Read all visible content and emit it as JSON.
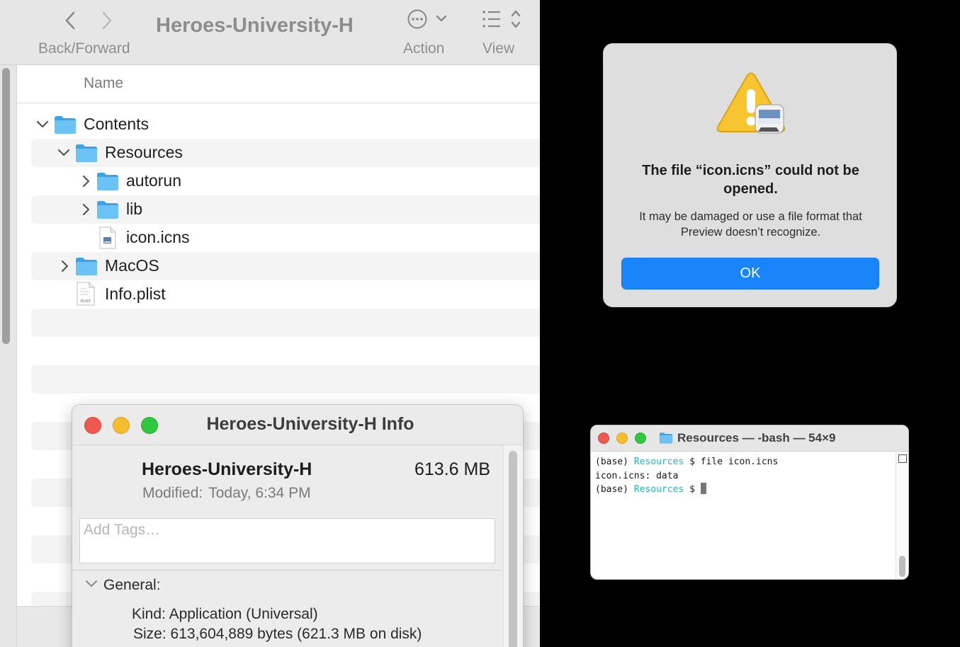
{
  "finder": {
    "title": "Heroes-University-H",
    "toolbar": {
      "nav_label": "Back/Forward",
      "action_label": "Action",
      "view_label": "View",
      "back_icon": "chevron-left-icon",
      "forward_icon": "chevron-right-icon",
      "action_icon": "ellipsis-circle-icon",
      "view_icon": "list-view-icon"
    },
    "column_header": "Name",
    "rows": [
      {
        "name": "Contents",
        "kind": "folder",
        "expanded": true,
        "depth": 0
      },
      {
        "name": "Resources",
        "kind": "folder",
        "expanded": true,
        "depth": 1
      },
      {
        "name": "autorun",
        "kind": "folder",
        "expanded": false,
        "depth": 2
      },
      {
        "name": "lib",
        "kind": "folder",
        "expanded": false,
        "depth": 2
      },
      {
        "name": "icon.icns",
        "kind": "file",
        "depth": 2
      },
      {
        "name": "MacOS",
        "kind": "folder",
        "expanded": false,
        "depth": 1
      },
      {
        "name": "Info.plist",
        "kind": "plist",
        "depth": 1
      }
    ],
    "plist_badge": "PLIST"
  },
  "info": {
    "window_title": "Heroes-University-H Info",
    "name": "Heroes-University-H",
    "size": "613.6 MB",
    "modified_label": "Modified:",
    "modified_value": "Today, 6:34 PM",
    "tags_placeholder": "Add Tags…",
    "general_label": "General:",
    "kind_label": "Kind:",
    "kind_value": "Application (Universal)",
    "size_label": "Size:",
    "size_value": "613,604,889 bytes (621.3 MB on disk)"
  },
  "alert": {
    "title": "The file “icon.icns” could not be opened.",
    "message": "It may be damaged or use a file format that Preview doesn’t recognize.",
    "ok_label": "OK",
    "icon": "warning-triangle-icon",
    "accent": "#1a84fb"
  },
  "terminal": {
    "title": "Resources — -bash — 54×9",
    "lines": [
      {
        "prefix": "(base) ",
        "dir": "Resources",
        "rest": " $ file icon.icns"
      },
      {
        "text": "icon.icns: data"
      },
      {
        "prefix": "(base) ",
        "dir": "Resources",
        "rest": " $ "
      }
    ]
  },
  "colors": {
    "folder_blue": "#5cb8ef",
    "terminal_cyan": "#2ab3bd",
    "traffic_red": "#ee5a52",
    "traffic_yellow": "#f5bd2f",
    "traffic_green": "#2ec841"
  }
}
